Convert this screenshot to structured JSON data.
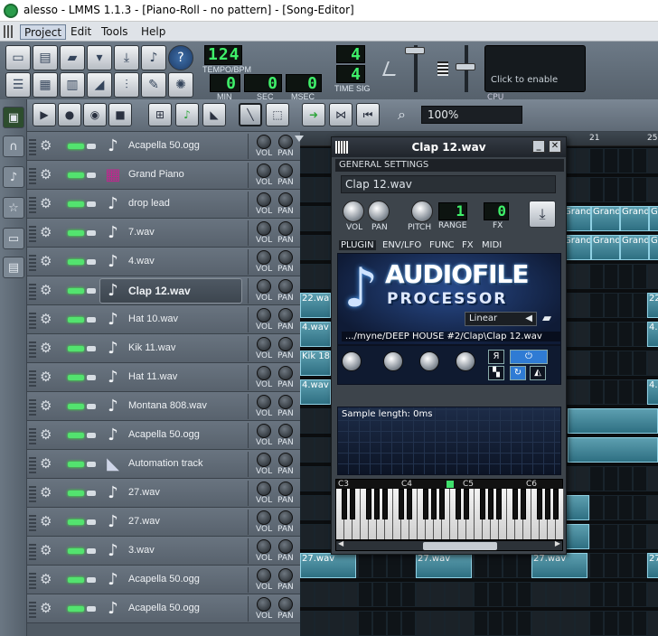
{
  "window": {
    "title": "alesso - LMMS 1.1.3 - [Piano-Roll - no pattern] - [Song-Editor]"
  },
  "menu": {
    "items": [
      "Project",
      "Edit",
      "Tools",
      "Help"
    ]
  },
  "toolbar": {
    "tempo_value": "124",
    "tempo_label": "TEMPO/BPM",
    "min_value": "0",
    "min_label": "MIN",
    "sec_value": "0",
    "sec_label": "SEC",
    "msec_value": "0",
    "msec_label": "MSEC",
    "timesig_num": "4",
    "timesig_den": "4",
    "timesig_label": "TIME SIG",
    "cpu_hint": "Click to enable",
    "cpu_label": "CPU"
  },
  "song_editor": {
    "zoom": "100%"
  },
  "ruler": {
    "marks": [
      "21",
      "25"
    ]
  },
  "tracks": [
    {
      "name": "Acapella 50.ogg",
      "icon": "audio-file-icon"
    },
    {
      "name": "Grand Piano",
      "icon": "sf2-player-icon"
    },
    {
      "name": "drop lead",
      "icon": "audio-file-icon"
    },
    {
      "name": "7.wav",
      "icon": "audio-file-icon"
    },
    {
      "name": "4.wav",
      "icon": "audio-file-icon"
    },
    {
      "name": "Clap 12.wav",
      "icon": "audio-file-icon",
      "selected": true
    },
    {
      "name": "Hat 10.wav",
      "icon": "audio-file-icon"
    },
    {
      "name": "Kik 11.wav",
      "icon": "audio-file-icon"
    },
    {
      "name": "Hat 11.wav",
      "icon": "audio-file-icon"
    },
    {
      "name": "Montana 808.wav",
      "icon": "audio-file-icon"
    },
    {
      "name": "Acapella 50.ogg",
      "icon": "audio-file-icon"
    },
    {
      "name": "Automation track",
      "icon": "automation-icon"
    },
    {
      "name": "27.wav",
      "icon": "audio-file-icon"
    },
    {
      "name": "27.wav",
      "icon": "audio-file-icon"
    },
    {
      "name": "3.wav",
      "icon": "audio-file-icon"
    },
    {
      "name": "Acapella 50.ogg",
      "icon": "audio-file-icon"
    },
    {
      "name": "Acapella 50.ogg",
      "icon": "audio-file-icon"
    }
  ],
  "track_labels": {
    "vol": "VOL",
    "pan": "PAN"
  },
  "clips": {
    "grand": "Grand",
    "wav22": "22.wav",
    "wav4": "4.wav",
    "kik": "Kik 18.",
    "wav27": "27.wav"
  },
  "plugin": {
    "title": "Clap 12.wav",
    "general_settings": "GENERAL SETTINGS",
    "name_field": "Clap 12.wav",
    "vol_label": "VOL",
    "pan_label": "PAN",
    "pitch_label": "PITCH",
    "range_value": "1",
    "range_label": "RANGE",
    "fx_value": "0",
    "fx_label": "FX",
    "tabs": [
      "PLUGIN",
      "ENV/LFO",
      "FUNC",
      "FX",
      "MIDI"
    ],
    "afp_title": "AUDIOFILE",
    "afp_subtitle": "PROCESSOR",
    "interpolation": "Linear",
    "sample_path": ".../myne/DEEP HOUSE #2/Clap\\Clap 12.wav",
    "sample_length": "Sample length: 0ms",
    "octaves": [
      "C3",
      "C4",
      "C5",
      "C6"
    ]
  }
}
